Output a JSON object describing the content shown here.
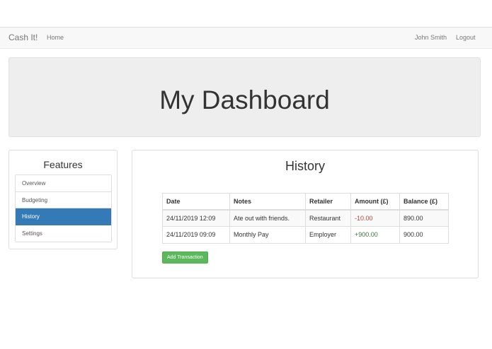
{
  "navbar": {
    "brand": "Cash It!",
    "home": "Home",
    "user": "John Smith",
    "logout": "Logout"
  },
  "jumbotron": {
    "title": "My Dashboard"
  },
  "features": {
    "title": "Features",
    "items": [
      {
        "label": "Overview",
        "active": false
      },
      {
        "label": "Budgeting",
        "active": false
      },
      {
        "label": "History",
        "active": true
      },
      {
        "label": "Settings",
        "active": false
      }
    ]
  },
  "history": {
    "title": "History",
    "columns": [
      "Date",
      "Notes",
      "Retailer",
      "Amount (£)",
      "Balance (£)"
    ],
    "rows": [
      {
        "date": "24/11/2019 12:09",
        "notes": "Ate out with friends.",
        "retailer": "Restaurant",
        "amount": "-10.00",
        "balance": "890.00"
      },
      {
        "date": "24/11/2019 09:09",
        "notes": "Monthly Pay",
        "retailer": "Employer",
        "amount": "+900.00",
        "balance": "900.00"
      }
    ],
    "add_button": "Add Transaction"
  },
  "colors": {
    "active": "#337ab7",
    "success": "#5cb85c",
    "negative": "#a94442",
    "positive": "#3c763d"
  }
}
